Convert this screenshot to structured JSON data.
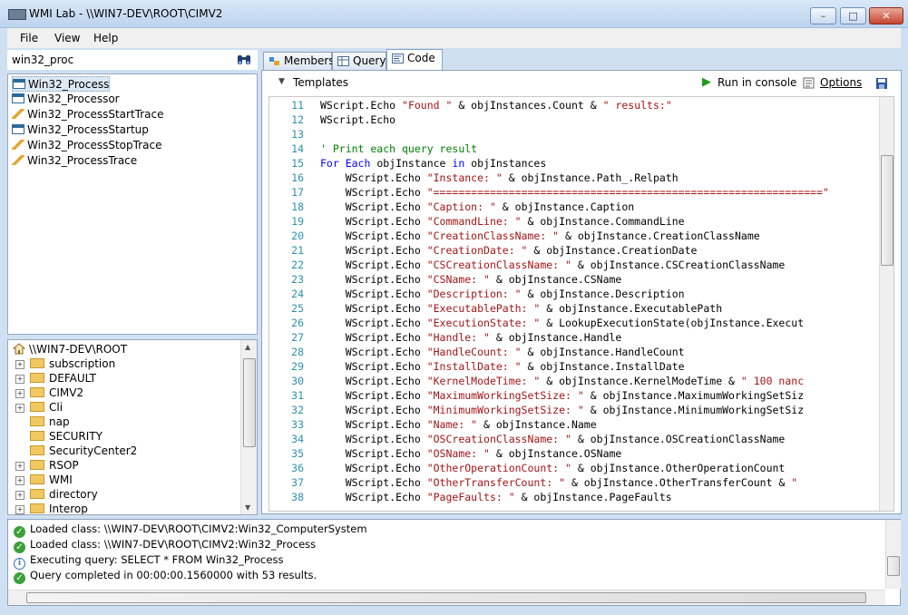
{
  "window": {
    "title": "WMI Lab - \\\\WIN7-DEV\\ROOT\\CIMV2",
    "minimize": "–",
    "maximize": "□",
    "close": "✕"
  },
  "menu": {
    "items": [
      "File",
      "View",
      "Help"
    ]
  },
  "search": {
    "value": "win32_proc"
  },
  "classes": [
    {
      "label": "Win32_Process",
      "icon": "class-icon"
    },
    {
      "label": "Win32_Processor",
      "icon": "class-icon"
    },
    {
      "label": "Win32_ProcessStartTrace",
      "icon": "event-icon"
    },
    {
      "label": "Win32_ProcessStartup",
      "icon": "class-icon"
    },
    {
      "label": "Win32_ProcessStopTrace",
      "icon": "event-icon"
    },
    {
      "label": "Win32_ProcessTrace",
      "icon": "event-icon"
    }
  ],
  "tree": {
    "root": "\\\\WIN7-DEV\\ROOT",
    "items": [
      {
        "label": "subscription",
        "expandable": true
      },
      {
        "label": "DEFAULT",
        "expandable": true
      },
      {
        "label": "CIMV2",
        "expandable": true
      },
      {
        "label": "Cli",
        "expandable": true
      },
      {
        "label": "nap",
        "expandable": false
      },
      {
        "label": "SECURITY",
        "expandable": false
      },
      {
        "label": "SecurityCenter2",
        "expandable": false
      },
      {
        "label": "RSOP",
        "expandable": true
      },
      {
        "label": "WMI",
        "expandable": true
      },
      {
        "label": "directory",
        "expandable": true
      },
      {
        "label": "Interop",
        "expandable": true
      }
    ]
  },
  "tabs": [
    {
      "label": "Members"
    },
    {
      "label": "Query"
    },
    {
      "label": "Code"
    }
  ],
  "toolbar": {
    "templates": "Templates",
    "run": "Run in console",
    "options": "Options"
  },
  "code": {
    "lines": [
      {
        "n": "11",
        "seg": [
          [
            "",
            "WScript.Echo "
          ],
          [
            "st",
            "\"Found \""
          ],
          [
            "",
            " & objInstances.Count & "
          ],
          [
            "st",
            "\" results:\""
          ]
        ]
      },
      {
        "n": "12",
        "seg": [
          [
            "",
            "WScript.Echo"
          ]
        ]
      },
      {
        "n": "13",
        "seg": []
      },
      {
        "n": "14",
        "seg": [
          [
            "cm",
            "' Print each query result"
          ]
        ]
      },
      {
        "n": "15",
        "seg": [
          [
            "kw",
            "For Each"
          ],
          [
            "",
            " objInstance "
          ],
          [
            "kw",
            "in"
          ],
          [
            "",
            " objInstances"
          ]
        ]
      },
      {
        "n": "16",
        "seg": [
          [
            "",
            "    WScript.Echo "
          ],
          [
            "st",
            "\"Instance: \""
          ],
          [
            "",
            " & objInstance.Path_.Relpath"
          ]
        ]
      },
      {
        "n": "17",
        "seg": [
          [
            "",
            "    WScript.Echo "
          ],
          [
            "st",
            "\"==============================================================\""
          ]
        ]
      },
      {
        "n": "18",
        "seg": [
          [
            "",
            "    WScript.Echo "
          ],
          [
            "st",
            "\"Caption: \""
          ],
          [
            "",
            " & objInstance.Caption"
          ]
        ]
      },
      {
        "n": "19",
        "seg": [
          [
            "",
            "    WScript.Echo "
          ],
          [
            "st",
            "\"CommandLine: \""
          ],
          [
            "",
            " & objInstance.CommandLine"
          ]
        ]
      },
      {
        "n": "20",
        "seg": [
          [
            "",
            "    WScript.Echo "
          ],
          [
            "st",
            "\"CreationClassName: \""
          ],
          [
            "",
            " & objInstance.CreationClassName"
          ]
        ]
      },
      {
        "n": "21",
        "seg": [
          [
            "",
            "    WScript.Echo "
          ],
          [
            "st",
            "\"CreationDate: \""
          ],
          [
            "",
            " & objInstance.CreationDate"
          ]
        ]
      },
      {
        "n": "22",
        "seg": [
          [
            "",
            "    WScript.Echo "
          ],
          [
            "st",
            "\"CSCreationClassName: \""
          ],
          [
            "",
            " & objInstance.CSCreationClassName"
          ]
        ]
      },
      {
        "n": "23",
        "seg": [
          [
            "",
            "    WScript.Echo "
          ],
          [
            "st",
            "\"CSName: \""
          ],
          [
            "",
            " & objInstance.CSName"
          ]
        ]
      },
      {
        "n": "24",
        "seg": [
          [
            "",
            "    WScript.Echo "
          ],
          [
            "st",
            "\"Description: \""
          ],
          [
            "",
            " & objInstance.Description"
          ]
        ]
      },
      {
        "n": "25",
        "seg": [
          [
            "",
            "    WScript.Echo "
          ],
          [
            "st",
            "\"ExecutablePath: \""
          ],
          [
            "",
            " & objInstance.ExecutablePath"
          ]
        ]
      },
      {
        "n": "26",
        "seg": [
          [
            "",
            "    WScript.Echo "
          ],
          [
            "st",
            "\"ExecutionState: \""
          ],
          [
            "",
            " & LookupExecutionState(objInstance.Execut"
          ]
        ]
      },
      {
        "n": "27",
        "seg": [
          [
            "",
            "    WScript.Echo "
          ],
          [
            "st",
            "\"Handle: \""
          ],
          [
            "",
            " & objInstance.Handle"
          ]
        ]
      },
      {
        "n": "28",
        "seg": [
          [
            "",
            "    WScript.Echo "
          ],
          [
            "st",
            "\"HandleCount: \""
          ],
          [
            "",
            " & objInstance.HandleCount"
          ]
        ]
      },
      {
        "n": "29",
        "seg": [
          [
            "",
            "    WScript.Echo "
          ],
          [
            "st",
            "\"InstallDate: \""
          ],
          [
            "",
            " & objInstance.InstallDate"
          ]
        ]
      },
      {
        "n": "30",
        "seg": [
          [
            "",
            "    WScript.Echo "
          ],
          [
            "st",
            "\"KernelModeTime: \""
          ],
          [
            "",
            " & objInstance.KernelModeTime & "
          ],
          [
            "st",
            "\" 100 nanc"
          ]
        ]
      },
      {
        "n": "31",
        "seg": [
          [
            "",
            "    WScript.Echo "
          ],
          [
            "st",
            "\"MaximumWorkingSetSize: \""
          ],
          [
            "",
            " & objInstance.MaximumWorkingSetSiz"
          ]
        ]
      },
      {
        "n": "32",
        "seg": [
          [
            "",
            "    WScript.Echo "
          ],
          [
            "st",
            "\"MinimumWorkingSetSize: \""
          ],
          [
            "",
            " & objInstance.MinimumWorkingSetSiz"
          ]
        ]
      },
      {
        "n": "33",
        "seg": [
          [
            "",
            "    WScript.Echo "
          ],
          [
            "st",
            "\"Name: \""
          ],
          [
            "",
            " & objInstance.Name"
          ]
        ]
      },
      {
        "n": "34",
        "seg": [
          [
            "",
            "    WScript.Echo "
          ],
          [
            "st",
            "\"OSCreationClassName: \""
          ],
          [
            "",
            " & objInstance.OSCreationClassName"
          ]
        ]
      },
      {
        "n": "35",
        "seg": [
          [
            "",
            "    WScript.Echo "
          ],
          [
            "st",
            "\"OSName: \""
          ],
          [
            "",
            " & objInstance.OSName"
          ]
        ]
      },
      {
        "n": "36",
        "seg": [
          [
            "",
            "    WScript.Echo "
          ],
          [
            "st",
            "\"OtherOperationCount: \""
          ],
          [
            "",
            " & objInstance.OtherOperationCount"
          ]
        ]
      },
      {
        "n": "37",
        "seg": [
          [
            "",
            "    WScript.Echo "
          ],
          [
            "st",
            "\"OtherTransferCount: \""
          ],
          [
            "",
            " & objInstance.OtherTransferCount & "
          ],
          [
            "st",
            "\""
          ]
        ]
      },
      {
        "n": "38",
        "seg": [
          [
            "",
            "    WScript.Echo "
          ],
          [
            "st",
            "\"PageFaults: \""
          ],
          [
            "",
            " & objInstance.PageFaults"
          ]
        ]
      }
    ]
  },
  "log": [
    {
      "type": "ok",
      "text": "Loaded class: \\\\WIN7-DEV\\ROOT\\CIMV2:Win32_ComputerSystem"
    },
    {
      "type": "ok",
      "text": "Loaded class: \\\\WIN7-DEV\\ROOT\\CIMV2:Win32_Process"
    },
    {
      "type": "info",
      "text": "Executing query: SELECT * FROM Win32_Process"
    },
    {
      "type": "ok",
      "text": "Query completed in 00:00:00.1560000 with 53 results."
    }
  ]
}
